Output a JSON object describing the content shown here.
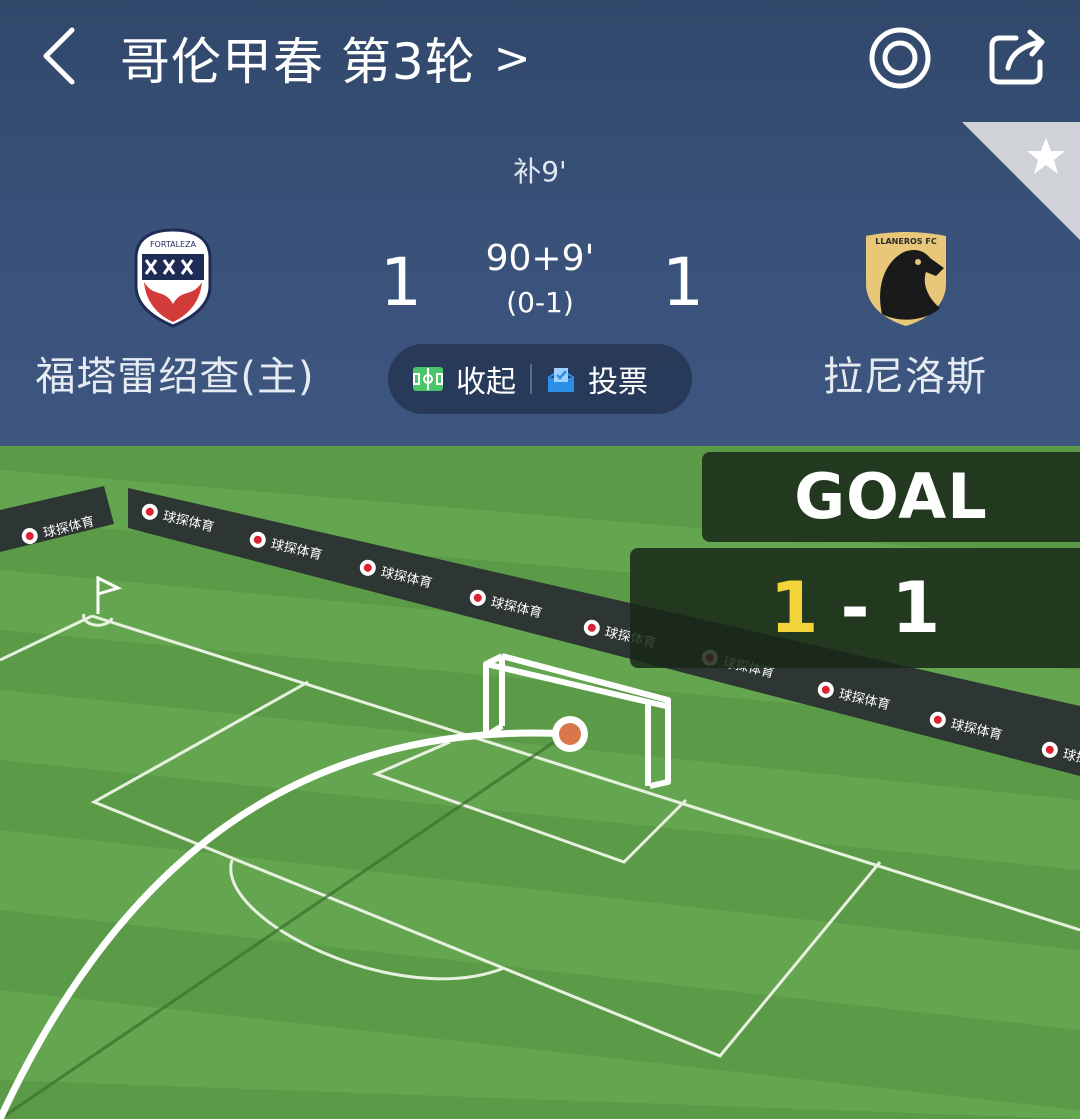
{
  "header": {
    "title": "哥伦甲春 第3轮",
    "title_arrow": ">",
    "icons": {
      "back": "chevron-left-icon",
      "target": "target-icon",
      "share": "share-icon",
      "favorite": "star-icon"
    }
  },
  "match": {
    "stoppage_label": "补9'",
    "time": "90+9'",
    "halftime_score": "(0-1)",
    "home": {
      "name": "福塔雷绍查(主)",
      "score": "1",
      "logo_text": "FORTALEZA"
    },
    "away": {
      "name": "拉尼洛斯",
      "score": "1",
      "logo_text": "LLANEROS FC"
    }
  },
  "actions": {
    "collapse_label": "收起",
    "vote_label": "投票"
  },
  "live": {
    "event_label": "GOAL",
    "home_score": "1",
    "separator": "-",
    "away_score": "1",
    "ad_text": "球探体育"
  },
  "colors": {
    "home_score_highlight": "#f2d43a",
    "ball": "#d9774a",
    "pitch": "#5b9a47"
  }
}
